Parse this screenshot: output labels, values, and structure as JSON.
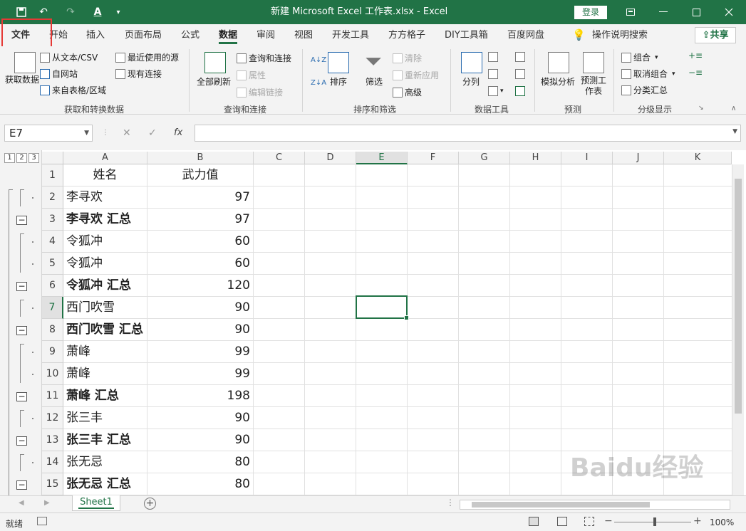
{
  "window": {
    "title": "新建 Microsoft Excel 工作表.xlsx  -  Excel",
    "login_label": "登录",
    "share_label": "共享"
  },
  "ribbon_tabs": [
    "文件",
    "开始",
    "插入",
    "页面布局",
    "公式",
    "数据",
    "审阅",
    "视图",
    "开发工具",
    "方方格子",
    "DIY工具箱",
    "百度网盘"
  ],
  "active_tab": "数据",
  "tell_me": "操作说明搜索",
  "ribbon": {
    "get_data": "获取数据",
    "from_text": "从文本/CSV",
    "recent_sources": "最近使用的源",
    "from_web": "自网站",
    "existing_connections": "现有连接",
    "from_table": "来自表格/区域",
    "group_get_transform": "获取和转换数据",
    "refresh_all": "全部刷新",
    "queries_connections": "查询和连接",
    "properties": "属性",
    "edit_links": "编辑链接",
    "group_queries": "查询和连接",
    "sort": "排序",
    "filter": "筛选",
    "clear": "清除",
    "reapply": "重新应用",
    "advanced": "高级",
    "group_sort_filter": "排序和筛选",
    "text_to_columns": "分列",
    "group_data_tools": "数据工具",
    "what_if": "模拟分析",
    "forecast_sheet": "预测工作表",
    "group_forecast": "预测",
    "group": "组合",
    "ungroup": "取消组合",
    "subtotal": "分类汇总",
    "group_outline": "分级显示"
  },
  "formula_bar": {
    "name_box": "E7",
    "fx": "fx",
    "value": ""
  },
  "outline_levels": [
    "1",
    "2",
    "3"
  ],
  "columns": [
    "A",
    "B",
    "C",
    "D",
    "E",
    "F",
    "G",
    "H",
    "I",
    "J",
    "K"
  ],
  "selected_column": "E",
  "selected_row": "7",
  "rows": [
    {
      "num": "1",
      "a": "姓名",
      "b": "武力值",
      "bold": false,
      "header": true
    },
    {
      "num": "2",
      "a": "李寻欢",
      "b": "97",
      "bold": false
    },
    {
      "num": "3",
      "a": "李寻欢 汇总",
      "b": "97",
      "bold": true
    },
    {
      "num": "4",
      "a": "令狐冲",
      "b": "60",
      "bold": false
    },
    {
      "num": "5",
      "a": "令狐冲",
      "b": "60",
      "bold": false
    },
    {
      "num": "6",
      "a": "令狐冲 汇总",
      "b": "120",
      "bold": true
    },
    {
      "num": "7",
      "a": "西门吹雪",
      "b": "90",
      "bold": false
    },
    {
      "num": "8",
      "a": "西门吹雪 汇总",
      "b": "90",
      "bold": true
    },
    {
      "num": "9",
      "a": "萧峰",
      "b": "99",
      "bold": false
    },
    {
      "num": "10",
      "a": "萧峰",
      "b": "99",
      "bold": false
    },
    {
      "num": "11",
      "a": "萧峰 汇总",
      "b": "198",
      "bold": true
    },
    {
      "num": "12",
      "a": "张三丰",
      "b": "90",
      "bold": false
    },
    {
      "num": "13",
      "a": "张三丰 汇总",
      "b": "90",
      "bold": true
    },
    {
      "num": "14",
      "a": "张无忌",
      "b": "80",
      "bold": false
    },
    {
      "num": "15",
      "a": "张无忌 汇总",
      "b": "80",
      "bold": true
    }
  ],
  "sheet_tab": "Sheet1",
  "status": {
    "ready": "就绪",
    "zoom": "100%"
  },
  "watermark": "Baidu经验"
}
